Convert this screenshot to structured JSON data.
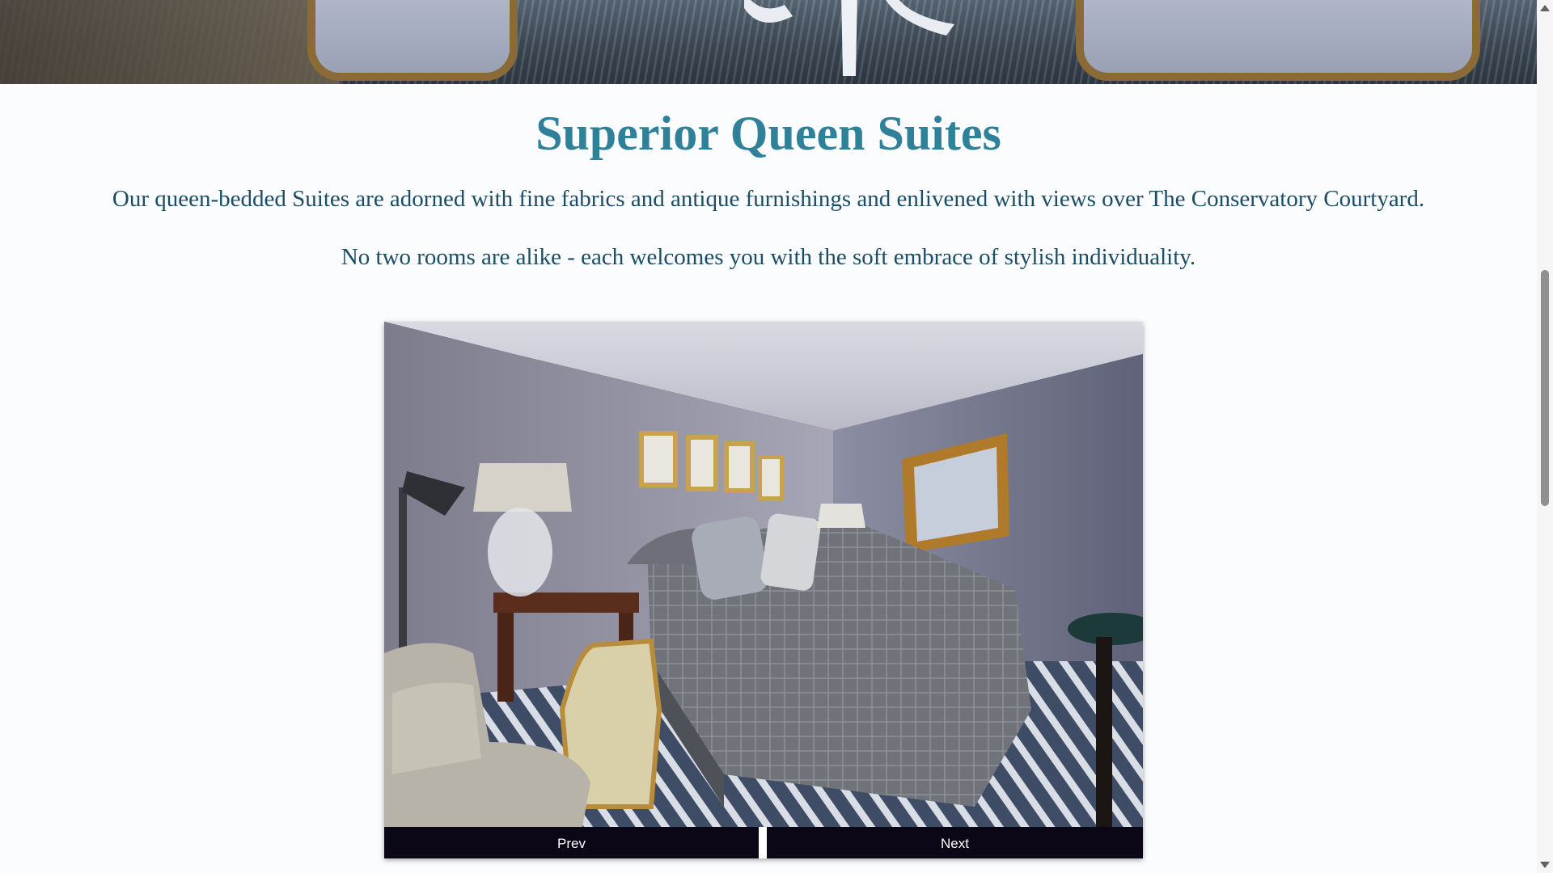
{
  "hero": {
    "image_alt": "Suite lounge chairs and carpet (cropped banner)"
  },
  "section": {
    "title": "Superior Queen Suites",
    "paragraphs": [
      "Our queen-bedded Suites are adorned with fine fabrics and antique furnishings and enlivened with views over The Conservatory Courtyard.",
      "No two rooms are alike - each welcomes you with the soft embrace of stylish individuality."
    ]
  },
  "gallery": {
    "image_alt": "Superior Queen Suite bedroom",
    "prev_label": "Prev",
    "next_label": "Next"
  },
  "colors": {
    "title": "#2f8199",
    "body_text": "#1b4d66",
    "nav_button_bg": "#0c0716",
    "page_bg": "#fbfcfd"
  }
}
